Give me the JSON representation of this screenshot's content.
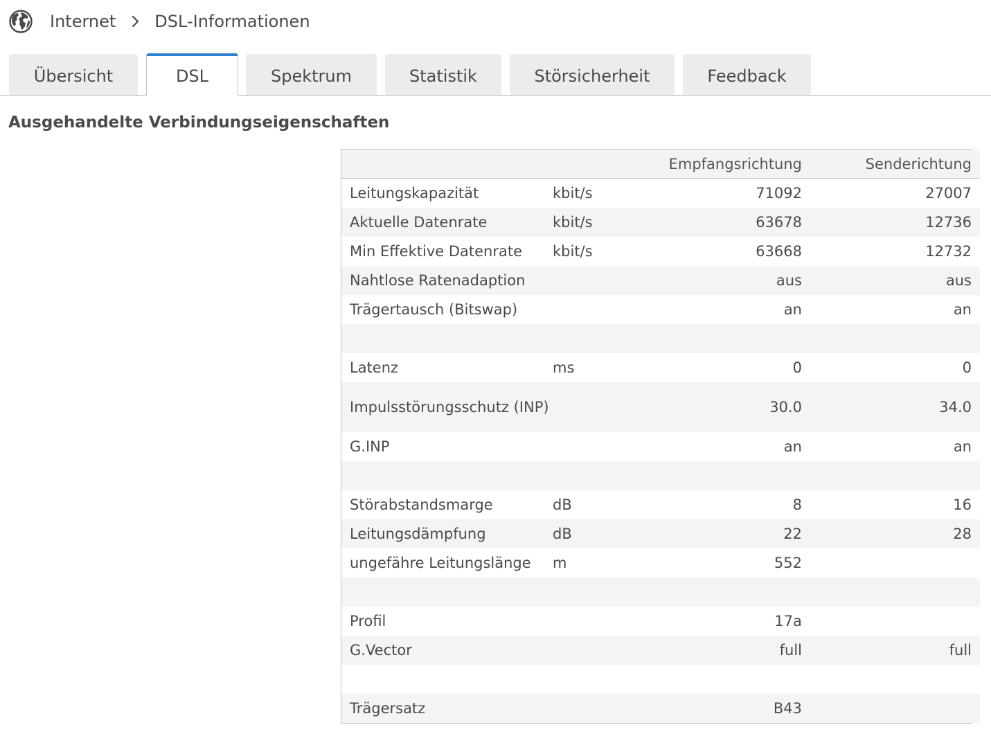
{
  "breadcrumb": {
    "icon": "globe-icon",
    "items": [
      "Internet",
      "DSL-Informationen"
    ]
  },
  "tabs": [
    {
      "label": "Übersicht",
      "active": false
    },
    {
      "label": "DSL",
      "active": true
    },
    {
      "label": "Spektrum",
      "active": false
    },
    {
      "label": "Statistik",
      "active": false
    },
    {
      "label": "Störsicherheit",
      "active": false
    },
    {
      "label": "Feedback",
      "active": false
    }
  ],
  "colors": {
    "accent": "#2f7fd0",
    "tab_bg": "#ececec",
    "row_alt": "#f4f4f4",
    "text": "#4a4a4a"
  },
  "section_title": "Ausgehandelte Verbindungseigenschaften",
  "table": {
    "headers": [
      "",
      "",
      "Empfangsrichtung",
      "Senderichtung"
    ],
    "rows": [
      {
        "label": "Leitungskapazität",
        "unit": "kbit/s",
        "rx": "71092",
        "tx": "27007"
      },
      {
        "label": "Aktuelle Datenrate",
        "unit": "kbit/s",
        "rx": "63678",
        "tx": "12736"
      },
      {
        "label": "Min Effektive Datenrate",
        "unit": "kbit/s",
        "rx": "63668",
        "tx": "12732"
      },
      {
        "label": "Nahtlose Ratenadaption",
        "unit": "",
        "rx": "aus",
        "tx": "aus"
      },
      {
        "label": "Trägertausch (Bitswap)",
        "unit": "",
        "rx": "an",
        "tx": "an"
      },
      {
        "label": "",
        "unit": "",
        "rx": "",
        "tx": ""
      },
      {
        "label": "Latenz",
        "unit": "ms",
        "rx": "0",
        "tx": "0"
      },
      {
        "label": "Impulsstörungsschutz (INP)",
        "unit": "",
        "rx": "30.0",
        "tx": "34.0"
      },
      {
        "label": "G.INP",
        "unit": "",
        "rx": "an",
        "tx": "an"
      },
      {
        "label": "",
        "unit": "",
        "rx": "",
        "tx": ""
      },
      {
        "label": "Störabstandsmarge",
        "unit": "dB",
        "rx": "8",
        "tx": "16"
      },
      {
        "label": "Leitungsdämpfung",
        "unit": "dB",
        "rx": "22",
        "tx": "28"
      },
      {
        "label": "ungefähre Leitungslänge",
        "unit": "m",
        "rx": "552",
        "tx": ""
      },
      {
        "label": "",
        "unit": "",
        "rx": "",
        "tx": ""
      },
      {
        "label": "Profil",
        "unit": "",
        "rx": "17a",
        "tx": ""
      },
      {
        "label": "G.Vector",
        "unit": "",
        "rx": "full",
        "tx": "full"
      },
      {
        "label": "",
        "unit": "",
        "rx": "",
        "tx": ""
      },
      {
        "label": "Trägersatz",
        "unit": "",
        "rx": "B43",
        "tx": ""
      }
    ]
  }
}
